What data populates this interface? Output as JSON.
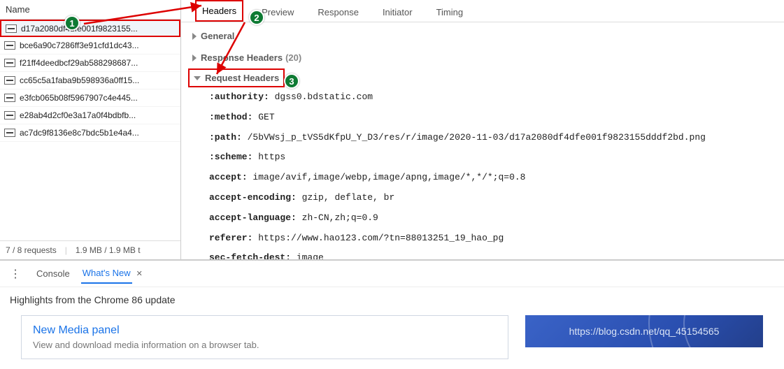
{
  "leftHeader": "Name",
  "requests": [
    "d17a2080df4dfe001f9823155...",
    "bce6a90c7286ff3e91cfd1dc43...",
    "f21ff4deedbcf29ab588298687...",
    "cc65c5a1faba9b598936a0ff15...",
    "e3fcb065b08f5967907c4e445...",
    "e28ab4d2cf0e3a17a0f4bdbfb...",
    "ac7dc9f8136e8c7bdc5b1e4a4..."
  ],
  "status": {
    "req": "7 / 8 requests",
    "size": "1.9 MB / 1.9 MB t"
  },
  "tabs": [
    "Headers",
    "Preview",
    "Response",
    "Initiator",
    "Timing"
  ],
  "sections": {
    "general": "General",
    "response": "Response Headers",
    "responseCount": "(20)",
    "request": "Request Headers"
  },
  "headers": [
    {
      "k": ":authority",
      "v": "dgss0.bdstatic.com"
    },
    {
      "k": ":method",
      "v": "GET"
    },
    {
      "k": ":path",
      "v": "/5bVWsj_p_tVS5dKfpU_Y_D3/res/r/image/2020-11-03/d17a2080df4dfe001f9823155dddf2bd.png"
    },
    {
      "k": ":scheme",
      "v": "https"
    },
    {
      "k": "accept",
      "v": "image/avif,image/webp,image/apng,image/*,*/*;q=0.8"
    },
    {
      "k": "accept-encoding",
      "v": "gzip, deflate, br"
    },
    {
      "k": "accept-language",
      "v": "zh-CN,zh;q=0.9"
    },
    {
      "k": "referer",
      "v": "https://www.hao123.com/?tn=88013251_19_hao_pg"
    },
    {
      "k": "sec-fetch-dest",
      "v": "image"
    }
  ],
  "drawer": {
    "tabs": {
      "console": "Console",
      "whatsnew": "What's New"
    },
    "highlight": "Highlights from the Chrome 86 update",
    "card": {
      "title": "New Media panel",
      "sub": "View and download media information on a browser tab."
    },
    "watermark": "https://blog.csdn.net/qq_45154565"
  },
  "annotations": {
    "a1": "1",
    "a2": "2",
    "a3": "3"
  }
}
